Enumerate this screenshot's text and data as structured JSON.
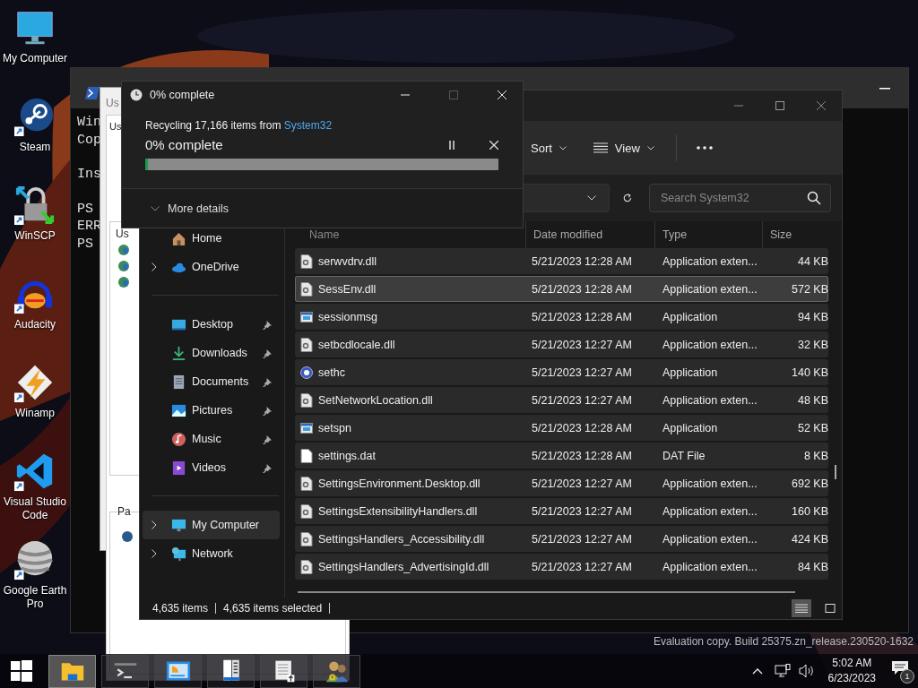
{
  "desktop": {
    "icons": [
      {
        "label": "My Computer",
        "kind": "computer",
        "shortcut": false
      },
      {
        "label": "Steam",
        "kind": "steam",
        "shortcut": true
      },
      {
        "label": "WinSCP",
        "kind": "winscp",
        "shortcut": true
      },
      {
        "label": "Audacity",
        "kind": "audacity",
        "shortcut": true
      },
      {
        "label": "Winamp",
        "kind": "winamp",
        "shortcut": true
      },
      {
        "label": "Visual Studio Code",
        "kind": "vscode",
        "shortcut": true
      },
      {
        "label": "Google Earth Pro",
        "kind": "earth",
        "shortcut": true
      }
    ],
    "watermark": "Evaluation copy. Build 25375.zn_release.230520-1632"
  },
  "terminal_window": {
    "blocks": [
      [
        "Win",
        "Cop"
      ],
      [
        "Ins"
      ],
      [
        "PS",
        "ERR",
        "PS"
      ]
    ]
  },
  "properties_window": {
    "title": "Us",
    "tab": "Us",
    "label": "Us",
    "section": "Pa"
  },
  "explorer": {
    "toolbar": [
      {
        "label": "Sort",
        "kind": "sort"
      },
      {
        "label": "View",
        "kind": "view"
      }
    ],
    "search": {
      "placeholder": "Search System32"
    },
    "sidebar": {
      "groups": [
        [
          {
            "label": "Home",
            "kind": "home",
            "expandable": false,
            "pinned": false,
            "selected": false
          },
          {
            "label": "OneDrive",
            "kind": "cloud",
            "expandable": true,
            "pinned": false,
            "selected": false
          }
        ],
        [
          {
            "label": "Desktop",
            "kind": "desktop",
            "expandable": false,
            "pinned": true,
            "selected": false
          },
          {
            "label": "Downloads",
            "kind": "download",
            "expandable": false,
            "pinned": true,
            "selected": false
          },
          {
            "label": "Documents",
            "kind": "document",
            "expandable": false,
            "pinned": true,
            "selected": false
          },
          {
            "label": "Pictures",
            "kind": "pictures",
            "expandable": false,
            "pinned": true,
            "selected": false
          },
          {
            "label": "Music",
            "kind": "music",
            "expandable": false,
            "pinned": true,
            "selected": false
          },
          {
            "label": "Videos",
            "kind": "video",
            "expandable": false,
            "pinned": true,
            "selected": false
          }
        ],
        [
          {
            "label": "My Computer",
            "kind": "computer",
            "expandable": true,
            "pinned": false,
            "selected": true
          },
          {
            "label": "Network",
            "kind": "network",
            "expandable": true,
            "pinned": false,
            "selected": false
          }
        ]
      ]
    },
    "columns": [
      "Name",
      "Date modified",
      "Type",
      "Size"
    ],
    "rows": [
      {
        "name": "serwvdrv.dll",
        "date": "5/21/2023 12:28 AM",
        "type": "Application exten...",
        "size": "44 KB",
        "kind": "dll",
        "selected": true,
        "hovered": false
      },
      {
        "name": "SessEnv.dll",
        "date": "5/21/2023 12:28 AM",
        "type": "Application exten...",
        "size": "572 KB",
        "kind": "dll",
        "selected": true,
        "hovered": true
      },
      {
        "name": "sessionmsg",
        "date": "5/21/2023 12:28 AM",
        "type": "Application",
        "size": "94 KB",
        "kind": "app",
        "selected": true,
        "hovered": false
      },
      {
        "name": "setbcdlocale.dll",
        "date": "5/21/2023 12:27 AM",
        "type": "Application exten...",
        "size": "32 KB",
        "kind": "dll",
        "selected": true,
        "hovered": false
      },
      {
        "name": "sethc",
        "date": "5/21/2023 12:27 AM",
        "type": "Application",
        "size": "140 KB",
        "kind": "round",
        "selected": true,
        "hovered": false
      },
      {
        "name": "SetNetworkLocation.dll",
        "date": "5/21/2023 12:27 AM",
        "type": "Application exten...",
        "size": "48 KB",
        "kind": "dll",
        "selected": true,
        "hovered": false
      },
      {
        "name": "setspn",
        "date": "5/21/2023 12:28 AM",
        "type": "Application",
        "size": "52 KB",
        "kind": "app",
        "selected": true,
        "hovered": false
      },
      {
        "name": "settings.dat",
        "date": "5/21/2023 12:28 AM",
        "type": "DAT File",
        "size": "8 KB",
        "kind": "file",
        "selected": true,
        "hovered": false
      },
      {
        "name": "SettingsEnvironment.Desktop.dll",
        "date": "5/21/2023 12:27 AM",
        "type": "Application exten...",
        "size": "692 KB",
        "kind": "dll",
        "selected": true,
        "hovered": false
      },
      {
        "name": "SettingsExtensibilityHandlers.dll",
        "date": "5/21/2023 12:27 AM",
        "type": "Application exten...",
        "size": "160 KB",
        "kind": "dll",
        "selected": true,
        "hovered": false
      },
      {
        "name": "SettingsHandlers_Accessibility.dll",
        "date": "5/21/2023 12:27 AM",
        "type": "Application exten...",
        "size": "424 KB",
        "kind": "dll",
        "selected": true,
        "hovered": false
      },
      {
        "name": "SettingsHandlers_AdvertisingId.dll",
        "date": "5/21/2023 12:27 AM",
        "type": "Application exten...",
        "size": "84 KB",
        "kind": "dll",
        "selected": true,
        "hovered": false
      }
    ],
    "status": {
      "count": "4,635 items",
      "selection": "4,635 items selected"
    },
    "view_modes": [
      {
        "kind": "details",
        "selected": true
      },
      {
        "kind": "tiles",
        "selected": false
      }
    ]
  },
  "progress_dialog": {
    "title": "0% complete",
    "message": "Recycling 17,166 items from ",
    "source": "System32",
    "status": "0% complete",
    "progress": {
      "level": 0
    },
    "details": "More details"
  },
  "taskbar": {
    "apps": [
      {
        "kind": "explorer",
        "active": true
      },
      {
        "kind": "terminal",
        "active": false
      },
      {
        "kind": "chart",
        "active": false
      },
      {
        "kind": "columns",
        "active": false
      },
      {
        "kind": "list",
        "active": false
      },
      {
        "kind": "users",
        "active": false
      }
    ],
    "time": "5:02 AM",
    "date": "6/23/2023",
    "notifications": "1"
  }
}
